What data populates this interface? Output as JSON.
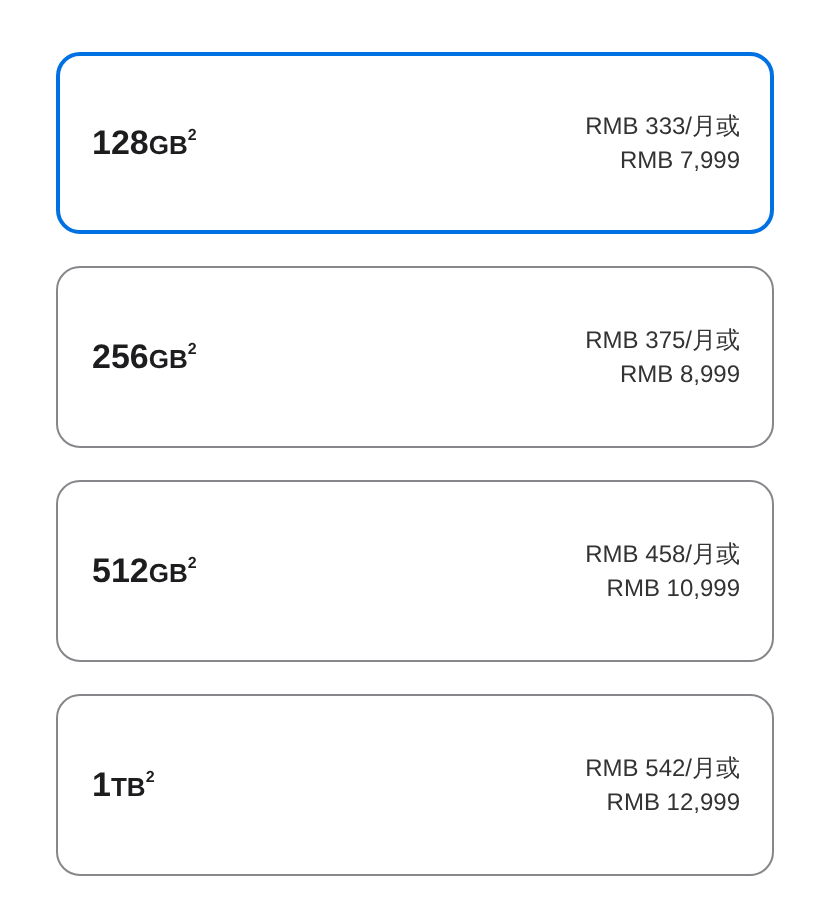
{
  "options": [
    {
      "capacity": "128",
      "unit": "GB",
      "footnote": "2",
      "monthly": "RMB 333/月或",
      "price": "RMB 7,999",
      "selected": true
    },
    {
      "capacity": "256",
      "unit": "GB",
      "footnote": "2",
      "monthly": "RMB 375/月或",
      "price": "RMB 8,999",
      "selected": false
    },
    {
      "capacity": "512",
      "unit": "GB",
      "footnote": "2",
      "monthly": "RMB 458/月或",
      "price": "RMB 10,999",
      "selected": false
    },
    {
      "capacity": "1",
      "unit": "TB",
      "footnote": "2",
      "monthly": "RMB 542/月或",
      "price": "RMB 12,999",
      "selected": false
    }
  ]
}
